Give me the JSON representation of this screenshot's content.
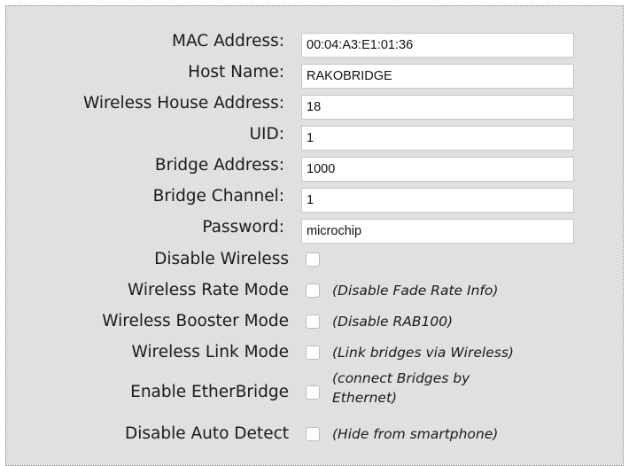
{
  "fields": [
    {
      "label": "MAC Address:",
      "value": "00:04:A3:E1:01:36"
    },
    {
      "label": "Host Name:",
      "value": "RAKOBRIDGE"
    },
    {
      "label": "Wireless House Address:",
      "value": "18"
    },
    {
      "label": "UID:",
      "value": "1"
    },
    {
      "label": "Bridge Address:",
      "value": "1000"
    },
    {
      "label": "Bridge Channel:",
      "value": "1"
    },
    {
      "label": "Password:",
      "value": "microchip"
    }
  ],
  "options": [
    {
      "label": "Disable Wireless",
      "note": "",
      "checked": false
    },
    {
      "label": "Wireless Rate Mode",
      "note": "(Disable Fade Rate Info)",
      "checked": false
    },
    {
      "label": "Wireless Booster Mode",
      "note": "(Disable RAB100)",
      "checked": false
    },
    {
      "label": "Wireless Link Mode",
      "note": "(Link bridges via Wireless)",
      "checked": false
    },
    {
      "label": "Enable EtherBridge",
      "note_line1": "(connect Bridges by",
      "note_line2": "Ethernet)",
      "checked": false
    },
    {
      "label": "Disable Auto Detect",
      "note": "(Hide from smartphone)",
      "checked": false
    }
  ]
}
